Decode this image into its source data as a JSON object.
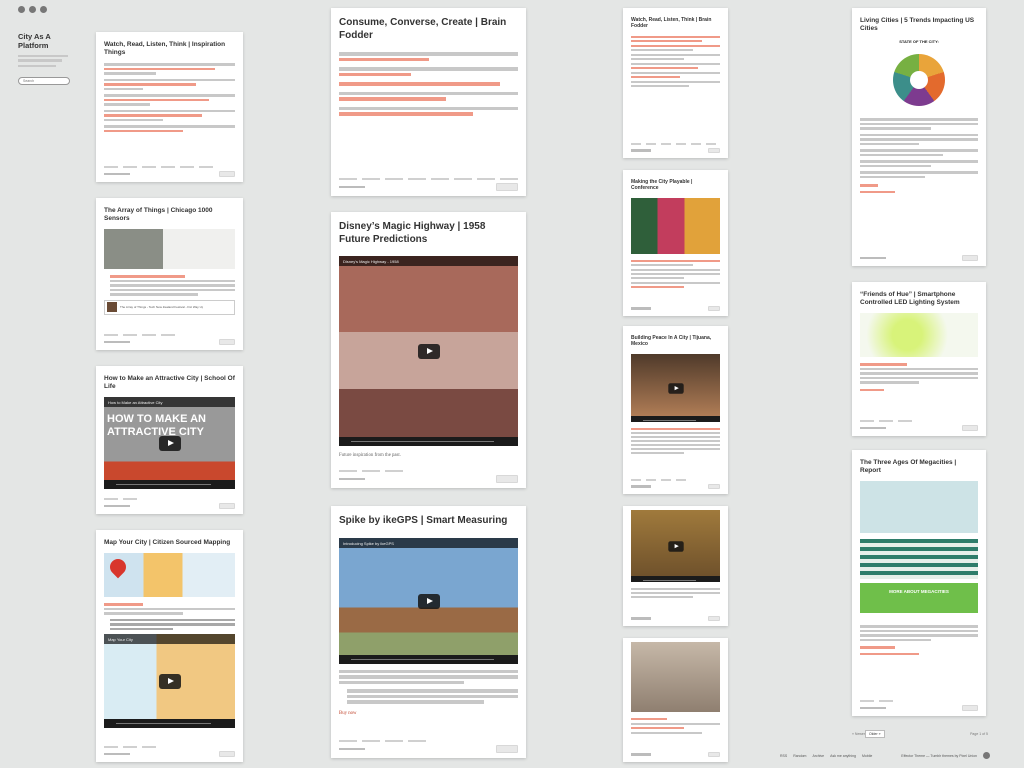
{
  "site": {
    "title": "City As A Platform",
    "search_placeholder": "Search"
  },
  "cards": {
    "watch_read": {
      "title": "Watch, Read, Listen, Think | Inspiration Things"
    },
    "array": {
      "title": "The Array of Things | Chicago 1000 Sensors",
      "video_caption": "The Array of Things - Tech New Zealand Festival - Fixi Way Up"
    },
    "attractive": {
      "title": "How to Make an Attractive City | School Of Life",
      "video_bar": "How to Make an Attractive City",
      "video_overlay": "HOW TO MAKE AN ATTRACTIVE CITY"
    },
    "map_city": {
      "title": "Map Your City | Citizen Sourced Mapping",
      "video_bar": "Map Your City"
    },
    "consume": {
      "title": "Consume, Converse, Create | Brain Fodder"
    },
    "disney": {
      "title": "Disney’s Magic Highway | 1958 Future Predictions",
      "video_bar": "Disney's Magic Highway - 1958",
      "caption": "Future inspiration from the past."
    },
    "spike": {
      "title": "Spike by ikeGPS | Smart Measuring",
      "video_bar": "Introducing Spike by ikeGPS",
      "link": "Buy now"
    },
    "watch_read2": {
      "title": "Watch, Read, Listen, Think | Brain Fodder"
    },
    "playable": {
      "title": "Making the City Playable | Conference"
    },
    "peace": {
      "title": "Building Peace In A City | Tijuana, Mexico"
    },
    "living": {
      "title": "Living Cities | 5 Trends Impacting US Cities",
      "image_title": "STATE OF THE CITY:"
    },
    "hue": {
      "title": "“Friends of Hue” | Smartphone Controlled LED Lighting System"
    },
    "megacities": {
      "title": "The Three Ages Of Megacities | Report",
      "image_caption": "MORE ABOUT MEGACITIES"
    }
  },
  "pager": {
    "prev": "« Newer",
    "page_select": "Older »",
    "page_label": "Page 1 of 5"
  },
  "footer": {
    "links": [
      "RSS",
      "Random",
      "Archive",
      "Ask me anything",
      "Mobile"
    ],
    "credit": "Effector Theme — Tumblr themes by Pixel Union"
  }
}
